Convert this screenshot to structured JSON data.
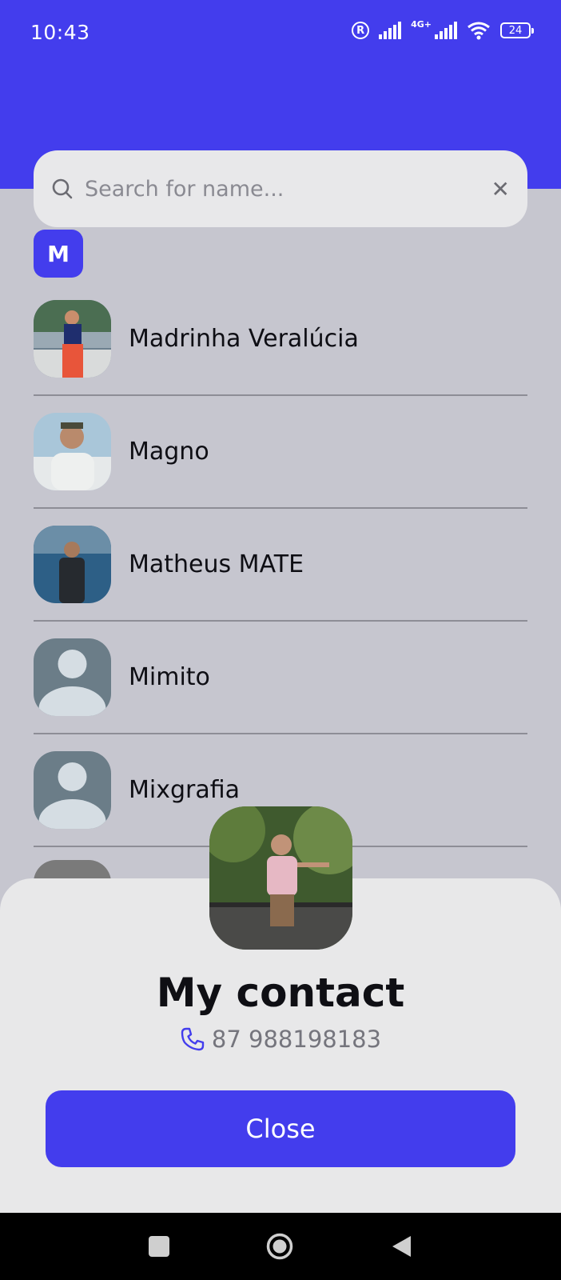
{
  "status_bar": {
    "time": "10:43",
    "registered_symbol": "R",
    "network_type": "4G+",
    "battery": "24"
  },
  "search": {
    "placeholder": "Search for name..."
  },
  "section_letter": "M",
  "contacts": [
    {
      "name": "Madrinha Veralúcia",
      "avatar": "photo"
    },
    {
      "name": "Magno",
      "avatar": "photo"
    },
    {
      "name": "Matheus MATE",
      "avatar": "photo"
    },
    {
      "name": "Mimito",
      "avatar": "default-person-icon"
    },
    {
      "name": "Mixgrafia",
      "avatar": "default-person-icon"
    }
  ],
  "sheet": {
    "title": "My contact",
    "phone": "87 988198183",
    "close_label": "Close"
  },
  "colors": {
    "accent": "#433ded",
    "list_bg": "#c6c6cf",
    "sheet_bg": "#e8e8e9"
  }
}
